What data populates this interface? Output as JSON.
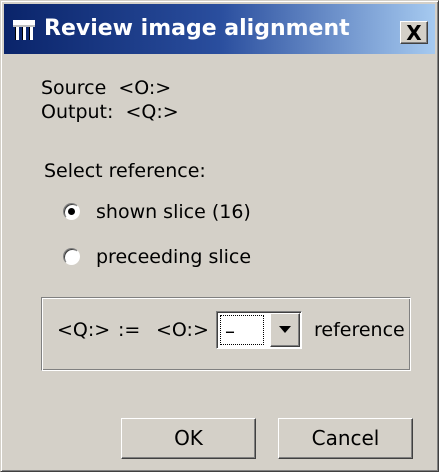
{
  "window": {
    "title": "Review image alignment",
    "close_label": "X",
    "title_gradient": [
      "#0a246a",
      "#a6caf0"
    ],
    "face_color": "#d4d0c8"
  },
  "info": {
    "source_label": "Source",
    "source_value": "<O:>",
    "output_label": "Output:",
    "output_value": "<Q:>"
  },
  "reference": {
    "heading": "Select reference:",
    "options": [
      {
        "label": "shown slice (16)",
        "selected": true
      },
      {
        "label": "preceeding slice",
        "selected": false
      }
    ]
  },
  "formula": {
    "lhs": "<Q:>",
    "assign": ":=",
    "operand": "<O:>",
    "operator_value": "–",
    "rhs": "reference"
  },
  "buttons": {
    "ok": "OK",
    "cancel": "Cancel"
  }
}
